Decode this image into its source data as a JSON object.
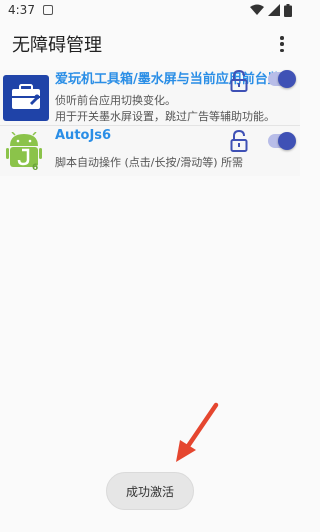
{
  "status_bar": {
    "time": "4:37"
  },
  "app_bar": {
    "title": "无障碍管理"
  },
  "services": [
    {
      "title": "爱玩机工具箱/墨水屏与当前应用前台监听",
      "desc_line1": "侦听前台应用切换变化。",
      "desc_line2": "用于开关墨水屏设置，跳过广告等辅助功能。",
      "enabled": true,
      "icon": "toolbox-icon"
    },
    {
      "title": "AutoJs6",
      "desc_line1": "脚本自动操作 (点击/长按/滑动等) 所需",
      "enabled": true,
      "icon": "autojs-icon"
    }
  ],
  "toast": {
    "text": "成功激活"
  },
  "colors": {
    "accent": "#3f51b5",
    "title_blue": "#2a8ee6",
    "arrow": "#e5462f"
  }
}
